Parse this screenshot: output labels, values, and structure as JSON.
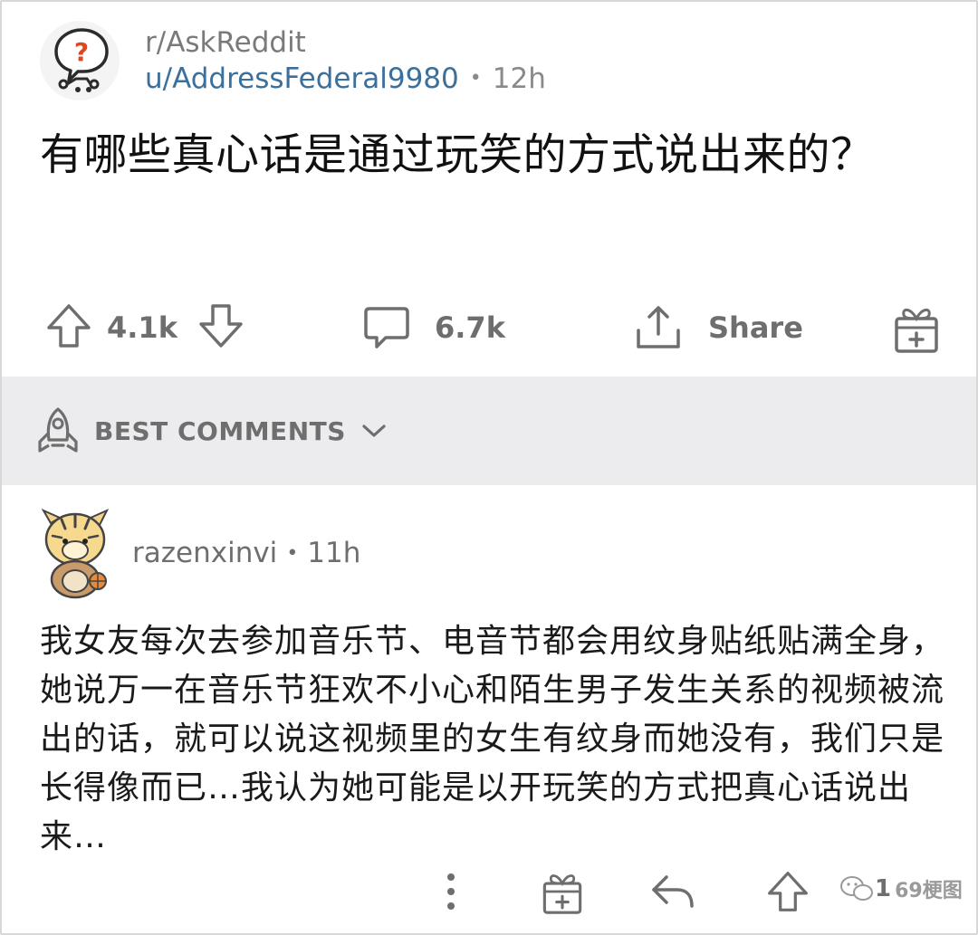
{
  "post": {
    "subreddit": "r/AskReddit",
    "author": "u/AddressFederal9980",
    "separator": "•",
    "age": "12h",
    "title": "有哪些真心话是通过玩笑的方式说出来的？",
    "subreddit_icon": "question-speech-bubble-icon"
  },
  "actions": {
    "votes": "4.1k",
    "comments": "6.7k",
    "share_label": "Share"
  },
  "sort": {
    "label": "BEST COMMENTS"
  },
  "comment": {
    "author": "razenxinvi",
    "separator": "•",
    "age": "11h",
    "body": "我女友每次去参加音乐节、电音节都会用纹身贴纸贴满全身，她说万一在音乐节狂欢不小心和陌生男子发生关系的视频被流出的话，就可以说这视频里的女生有纹身而她没有，我们只是长得像而已…我认为她可能是以开玩笑的方式把真心话说出来…",
    "vote_partial": "1"
  },
  "watermark": {
    "text": "69梗图"
  },
  "colors": {
    "username": "#3b6f9c",
    "muted": "#6e6e6e",
    "sort_bar": "#ececee"
  }
}
